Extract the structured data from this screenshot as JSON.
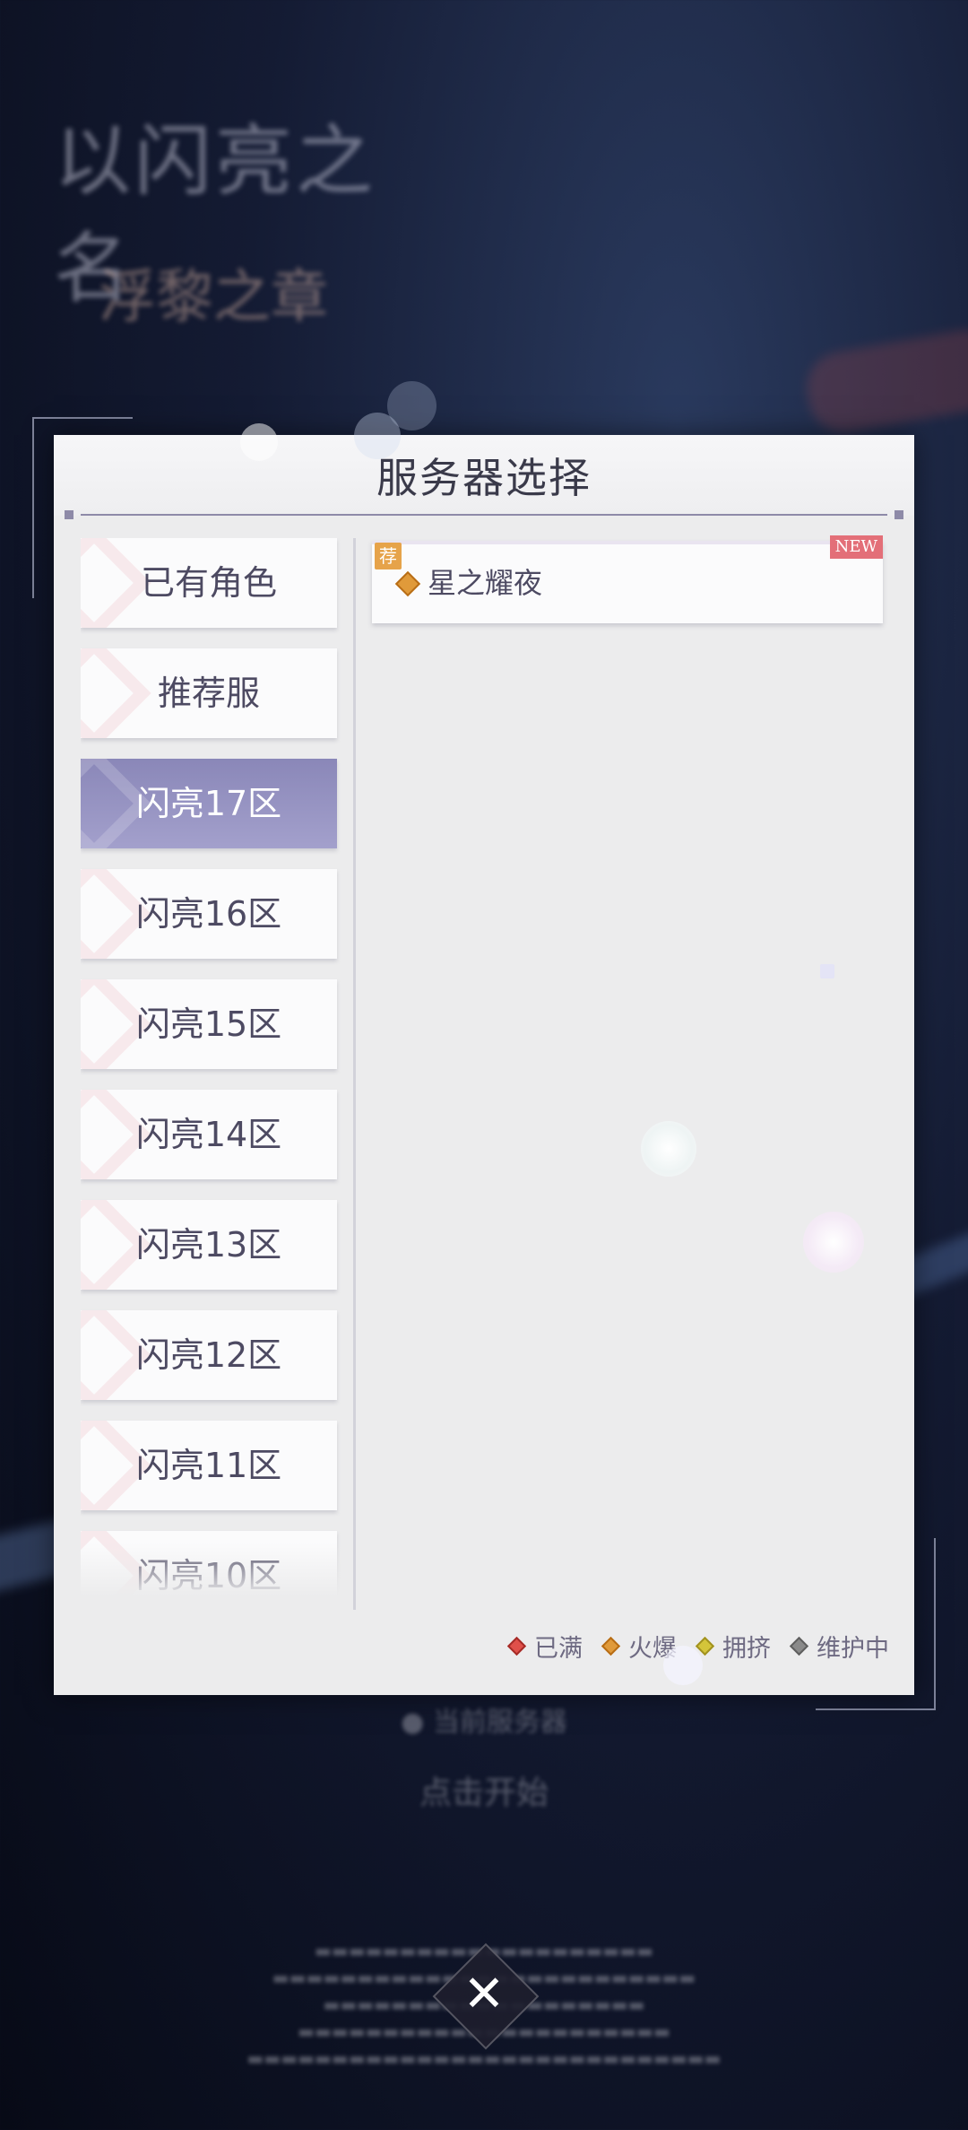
{
  "dialog": {
    "title": "服务器选择"
  },
  "zones": [
    {
      "label": "已有角色",
      "active": false
    },
    {
      "label": "推荐服",
      "active": false
    },
    {
      "label": "闪亮17区",
      "active": true
    },
    {
      "label": "闪亮16区",
      "active": false
    },
    {
      "label": "闪亮15区",
      "active": false
    },
    {
      "label": "闪亮14区",
      "active": false
    },
    {
      "label": "闪亮13区",
      "active": false
    },
    {
      "label": "闪亮12区",
      "active": false
    },
    {
      "label": "闪亮11区",
      "active": false
    },
    {
      "label": "闪亮10区",
      "active": false
    }
  ],
  "servers": [
    {
      "name": "星之耀夜",
      "recommend_badge": "荐",
      "new_badge": "NEW",
      "status": "火爆"
    }
  ],
  "legend": [
    {
      "label": "已满",
      "color": "#e0504a"
    },
    {
      "label": "火爆",
      "color": "#e09a3a"
    },
    {
      "label": "拥挤",
      "color": "#d4c53a"
    },
    {
      "label": "维护中",
      "color": "#888888"
    }
  ],
  "close_icon": "close-icon",
  "colors": {
    "active_zone": "#9895c4",
    "dialog_bg": "#ececed",
    "accent_line": "#8e8aa8"
  }
}
